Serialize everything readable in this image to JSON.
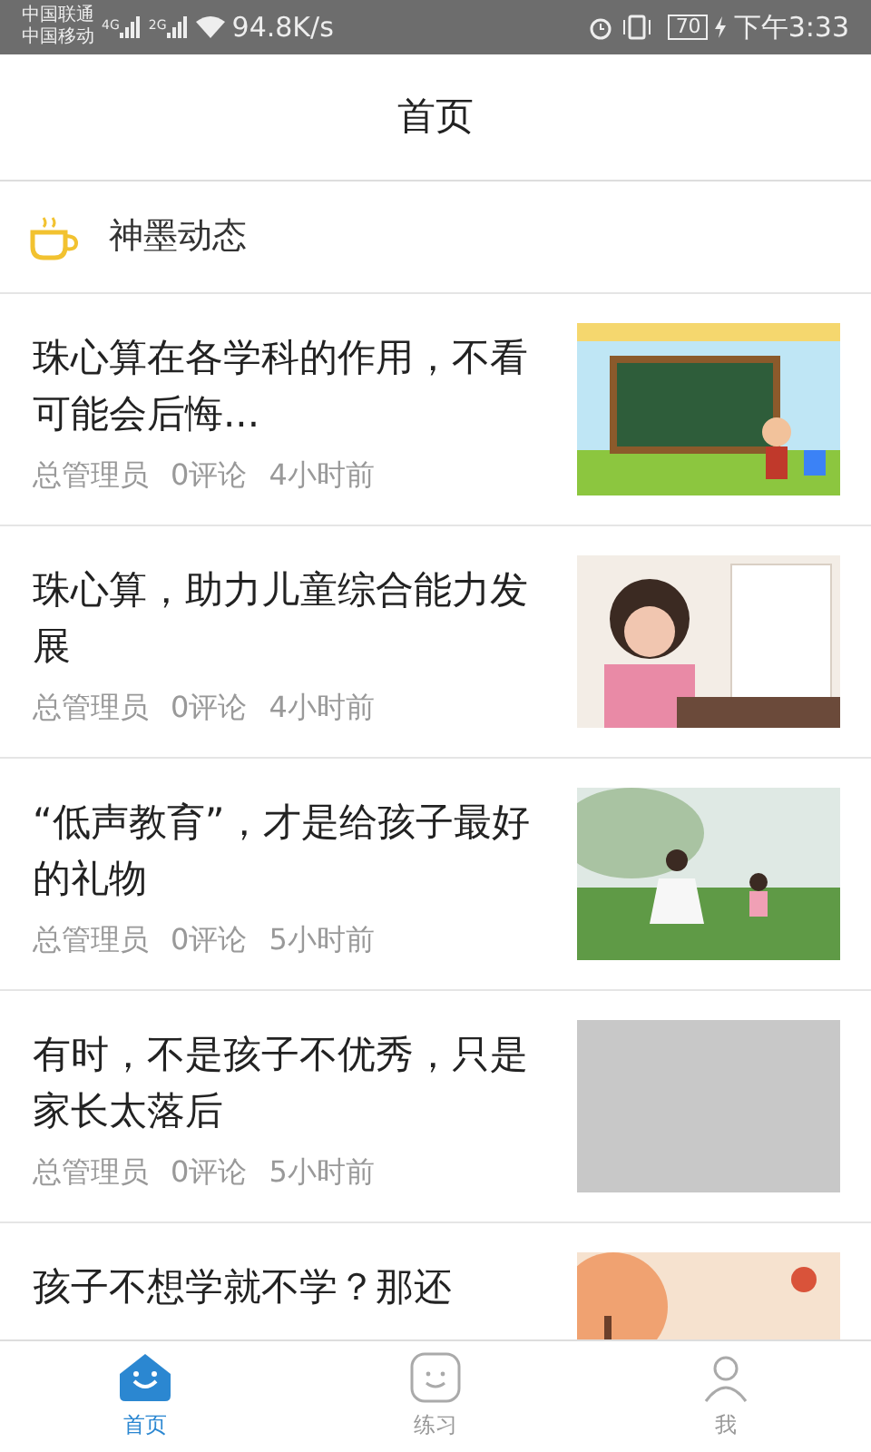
{
  "status_bar": {
    "carriers": [
      "中国联通",
      "中国移动"
    ],
    "network_types": [
      "4G",
      "2G"
    ],
    "speed": "94.8K/s",
    "battery": "70",
    "time": "下午3:33"
  },
  "header": {
    "title": "首页"
  },
  "section": {
    "title": "神墨动态"
  },
  "articles": [
    {
      "title": "珠心算在各学科的作用，不看可能会后悔...",
      "author": "总管理员",
      "comments": "0评论",
      "time": "4小时前"
    },
    {
      "title": "珠心算，助力儿童综合能力发展",
      "author": "总管理员",
      "comments": "0评论",
      "time": "4小时前"
    },
    {
      "title": "“低声教育”，才是给孩子最好的礼物",
      "author": "总管理员",
      "comments": "0评论",
      "time": "5小时前"
    },
    {
      "title": "有时，不是孩子不优秀，只是家长太落后",
      "author": "总管理员",
      "comments": "0评论",
      "time": "5小时前",
      "image": {
        "kind": "placeholder"
      }
    },
    {
      "title": "孩子不想学就不学？那还"
    }
  ],
  "tabs": [
    {
      "label": "首页",
      "selected": true
    },
    {
      "label": "练习",
      "selected": false
    },
    {
      "label": "我",
      "selected": false
    }
  ]
}
